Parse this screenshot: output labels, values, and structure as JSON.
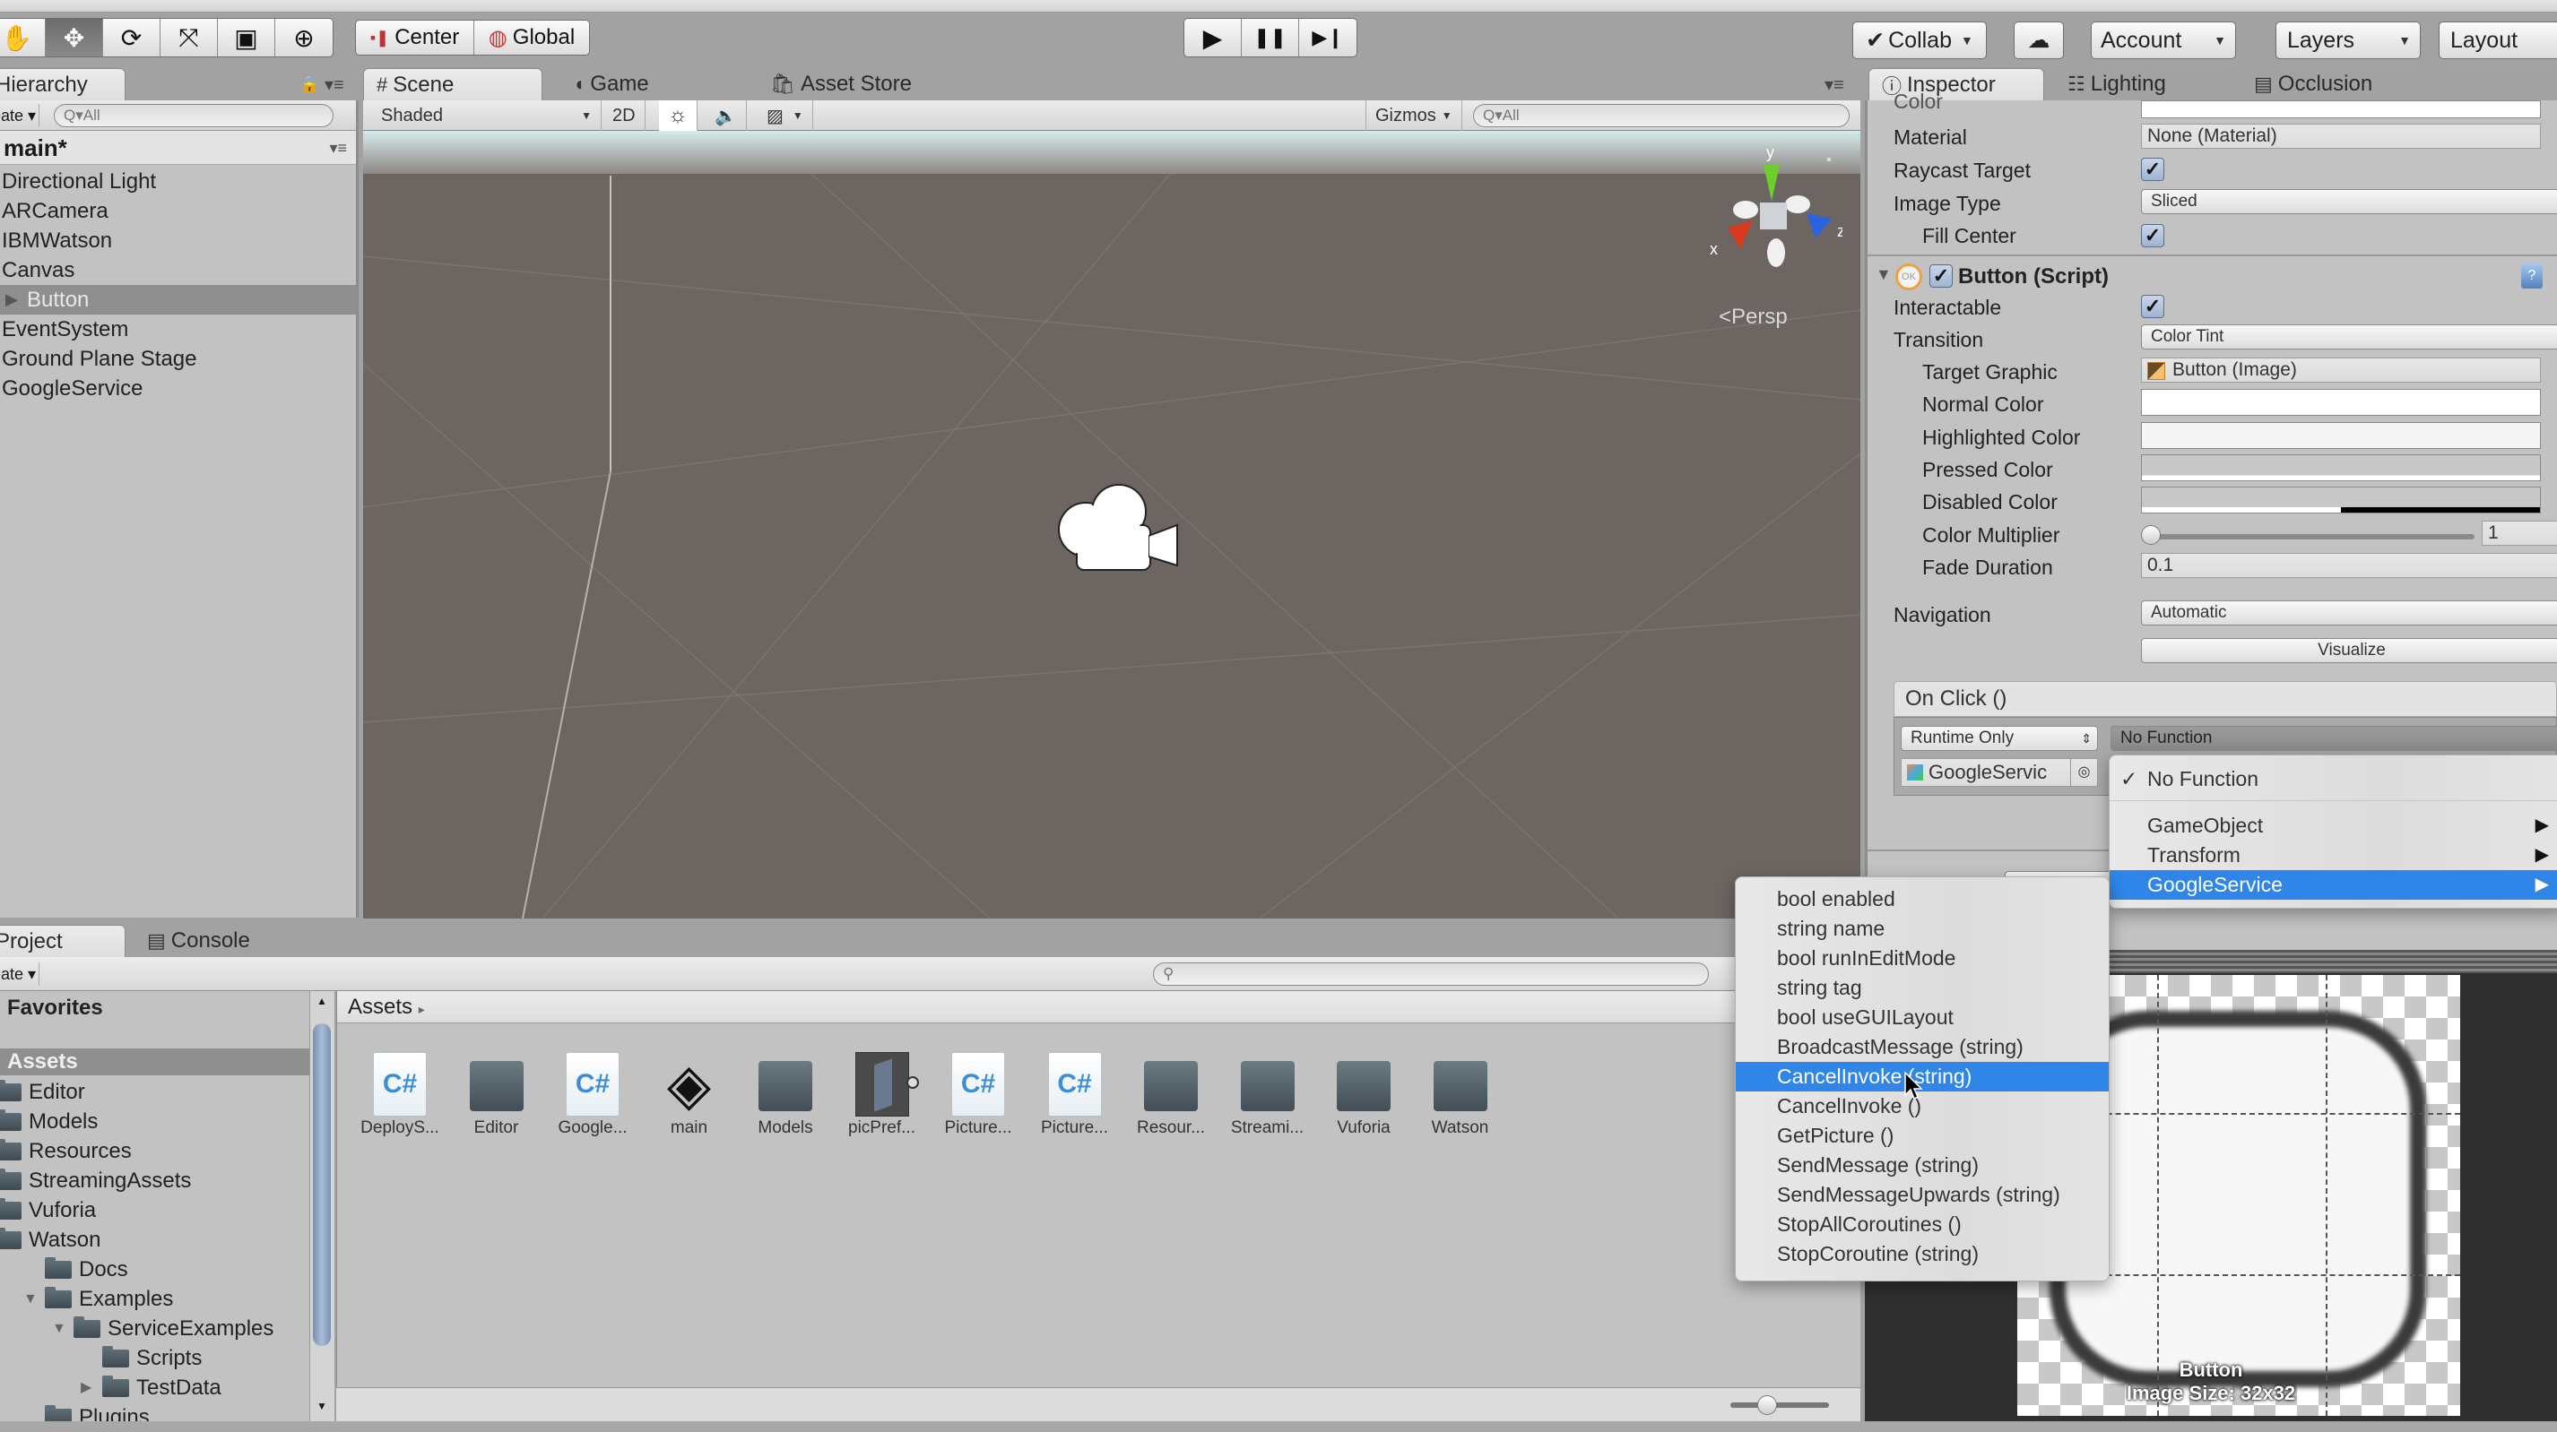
{
  "toolbar": {
    "tools": [
      {
        "name": "hand-tool",
        "glyph": "✋"
      },
      {
        "name": "move-tool",
        "glyph": "✥"
      },
      {
        "name": "rotate-tool",
        "glyph": "⟳"
      },
      {
        "name": "scale-tool",
        "glyph": "⤧"
      },
      {
        "name": "rect-tool",
        "glyph": "▣"
      },
      {
        "name": "transform-tool",
        "glyph": "⊕"
      }
    ],
    "active_tool": "move-tool",
    "pivot_label": "Center",
    "space_label": "Global",
    "play_glyph": "▶",
    "pause_glyph": "❚❚",
    "step_glyph": "▶❙",
    "collab_label": "Collab",
    "cloud_glyph": "☁",
    "account_label": "Account",
    "layers_label": "Layers",
    "layout_label": "Layout"
  },
  "hierarchy": {
    "tab_label": "Hierarchy",
    "create_label": "Create",
    "search_placeholder": "Q▾All",
    "scene_name": "main*",
    "items": [
      {
        "label": "Directional Light",
        "selected": false
      },
      {
        "label": "ARCamera",
        "selected": false
      },
      {
        "label": "IBMWatson",
        "selected": false
      },
      {
        "label": "Canvas",
        "selected": false
      },
      {
        "label": "Button",
        "selected": true
      },
      {
        "label": "EventSystem",
        "selected": false
      },
      {
        "label": "Ground Plane Stage",
        "selected": false
      },
      {
        "label": "GoogleService",
        "selected": false
      }
    ]
  },
  "scene": {
    "tabs": [
      {
        "label": "Scene",
        "icon": "#",
        "active": true
      },
      {
        "label": "Game",
        "icon": "◖",
        "active": false
      },
      {
        "label": "Asset Store",
        "icon": "🛍",
        "active": false
      }
    ],
    "shading_mode": "Shaded",
    "mode_2d": "2D",
    "lighting_glyph": "☼",
    "audio_glyph": "🔈",
    "effects_glyph": "▨",
    "gizmos_label": "Gizmos",
    "search_placeholder": "Q▾All",
    "projection_label": "Persp",
    "axis_labels": {
      "x": "x",
      "y": "y",
      "z": "z"
    },
    "axis_colors": {
      "x": "#d8391c",
      "y": "#6ccf2c",
      "z": "#2a62e0"
    }
  },
  "inspector": {
    "tabs": [
      {
        "label": "Inspector",
        "icon": "ⓘ",
        "active": true
      },
      {
        "label": "Lighting",
        "icon": "☷",
        "active": false
      },
      {
        "label": "Occlusion",
        "icon": "▤",
        "active": false
      }
    ],
    "image": {
      "color_label": "Color",
      "material_label": "Material",
      "material_value": "None (Material)",
      "raycast_label": "Raycast Target",
      "raycast_checked": true,
      "image_type_label": "Image Type",
      "image_type_value": "Sliced",
      "fill_center_label": "Fill Center",
      "fill_center_checked": true
    },
    "button_component": {
      "title": "Button (Script)",
      "enabled": true,
      "interactable_label": "Interactable",
      "interactable_checked": true,
      "transition_label": "Transition",
      "transition_value": "Color Tint",
      "target_graphic_label": "Target Graphic",
      "target_graphic_value": "Button (Image)",
      "normal_color_label": "Normal Color",
      "highlighted_color_label": "Highlighted Color",
      "pressed_color_label": "Pressed Color",
      "disabled_color_label": "Disabled Color",
      "color_multiplier_label": "Color Multiplier",
      "color_multiplier_value": "1",
      "color_multiplier_fraction": 0.0,
      "fade_duration_label": "Fade Duration",
      "fade_duration_value": "0.1",
      "navigation_label": "Navigation",
      "navigation_value": "Automatic",
      "visualize_label": "Visualize",
      "onclick_label": "On Click ()",
      "runtime_value": "Runtime Only",
      "function_value": "No Function",
      "target_object": "GoogleServic"
    }
  },
  "function_menu": {
    "items": [
      {
        "label": "No Function",
        "checked": true,
        "submenu": false,
        "highlighted": false
      },
      {
        "label": "GameObject",
        "checked": false,
        "submenu": true,
        "highlighted": false
      },
      {
        "label": "Transform",
        "checked": false,
        "submenu": true,
        "highlighted": false
      },
      {
        "label": "GoogleService",
        "checked": false,
        "submenu": true,
        "highlighted": true
      }
    ],
    "check_glyph": "✓",
    "arrow_glyph": "▶"
  },
  "google_service_submenu": {
    "items": [
      {
        "label": "bool enabled",
        "highlighted": false
      },
      {
        "label": "string name",
        "highlighted": false
      },
      {
        "label": "bool runInEditMode",
        "highlighted": false
      },
      {
        "label": "string tag",
        "highlighted": false
      },
      {
        "label": "bool useGUILayout",
        "highlighted": false
      },
      {
        "label": "BroadcastMessage (string)",
        "highlighted": false
      },
      {
        "label": "CancelInvoke (string)",
        "highlighted": true
      },
      {
        "label": "CancelInvoke ()",
        "highlighted": false
      },
      {
        "label": "GetPicture ()",
        "highlighted": false
      },
      {
        "label": "SendMessage (string)",
        "highlighted": false
      },
      {
        "label": "SendMessageUpwards (string)",
        "highlighted": false
      },
      {
        "label": "StopAllCoroutines ()",
        "highlighted": false
      },
      {
        "label": "StopCoroutine (string)",
        "highlighted": false
      }
    ]
  },
  "project": {
    "tabs": [
      {
        "label": "Project",
        "icon": "",
        "active": true
      },
      {
        "label": "Console",
        "icon": "▤",
        "active": false
      }
    ],
    "create_label": "Create",
    "favorites_label": "Favorites",
    "assets_root": "Assets",
    "tree": [
      {
        "label": "Editor",
        "depth": 0,
        "expander": ""
      },
      {
        "label": "Models",
        "depth": 0,
        "expander": ""
      },
      {
        "label": "Resources",
        "depth": 0,
        "expander": ""
      },
      {
        "label": "StreamingAssets",
        "depth": 0,
        "expander": ""
      },
      {
        "label": "Vuforia",
        "depth": 0,
        "expander": ""
      },
      {
        "label": "Watson",
        "depth": 0,
        "expander": ""
      },
      {
        "label": "Docs",
        "depth": 1,
        "expander": ""
      },
      {
        "label": "Examples",
        "depth": 1,
        "expander": "▼"
      },
      {
        "label": "ServiceExamples",
        "depth": 2,
        "expander": "▼"
      },
      {
        "label": "Scripts",
        "depth": 3,
        "expander": ""
      },
      {
        "label": "TestData",
        "depth": 3,
        "expander": "▶"
      },
      {
        "label": "Plugins",
        "depth": 1,
        "expander": ""
      }
    ],
    "breadcrumb": "Assets",
    "breadcrumb_arrow": "▸",
    "assets": [
      {
        "label": "DeployS...",
        "type": "script"
      },
      {
        "label": "Editor",
        "type": "folder"
      },
      {
        "label": "Google...",
        "type": "script"
      },
      {
        "label": "main",
        "type": "scene"
      },
      {
        "label": "Models",
        "type": "folder"
      },
      {
        "label": "picPref...",
        "type": "prefab"
      },
      {
        "label": "Picture...",
        "type": "script"
      },
      {
        "label": "Picture...",
        "type": "script"
      },
      {
        "label": "Resour...",
        "type": "folder"
      },
      {
        "label": "Streami...",
        "type": "folder"
      },
      {
        "label": "Vuforia",
        "type": "folder"
      },
      {
        "label": "Watson",
        "type": "folder"
      }
    ],
    "icon_size_fraction": 0.3
  },
  "preview": {
    "name": "Button",
    "size_text": "Image Size: 32x32"
  }
}
